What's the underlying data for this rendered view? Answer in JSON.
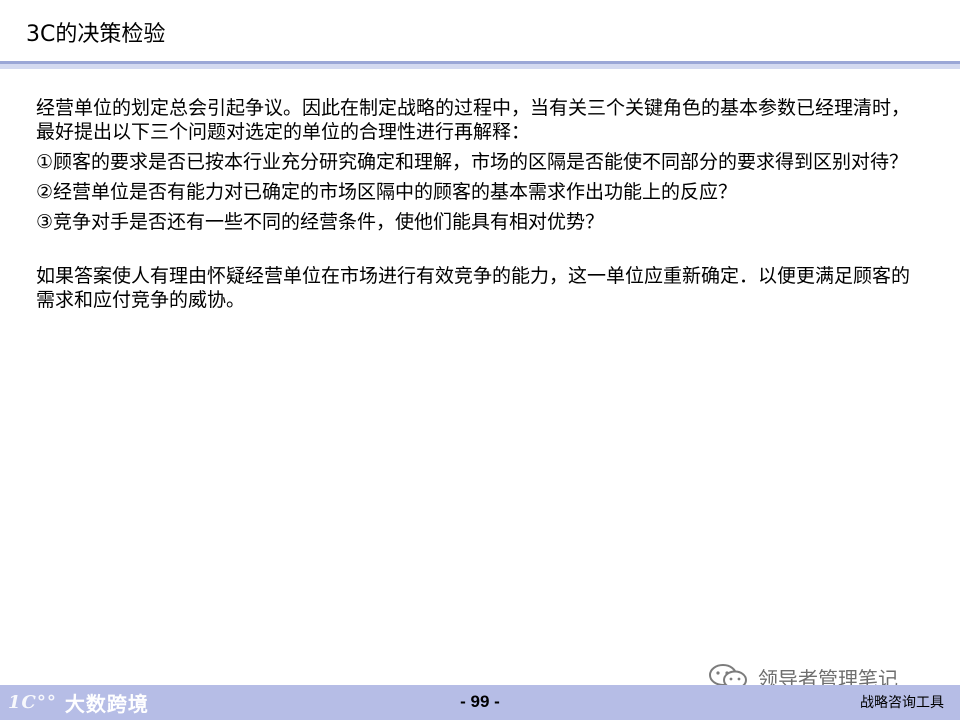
{
  "title": "3C的决策检验",
  "paragraphs": [
    "经营单位的划定总会引起争议。因此在制定战略的过程中，当有关三个关键角色的基本参数已经理清时，最好提出以下三个问题对选定的单位的合理性进行再解释：",
    "①顾客的要求是否已按本行业充分研究确定和理解，市场的区隔是否能使不同部分的要求得到区别对待？",
    "②经营单位是否有能力对已确定的市场区隔中的顾客的基本需求作出功能上的反应？",
    "③竞争对手是否还有一些不同的经营条件，使他们能具有相对优势？",
    "如果答案使人有理由怀疑经营单位在市场进行有效竞争的能力，这一单位应重新确定．以便更满足顾客的需求和应付竞争的威协。"
  ],
  "footer": {
    "logo_mark": "1C°°",
    "logo_text": "大数跨境",
    "page_number": "- 99 -",
    "right_text": "战略咨询工具"
  },
  "watermark": {
    "text": "领导者管理笔记"
  },
  "colors": {
    "title_rule": "#9aa6d6",
    "footer_band": "#b6bde6"
  }
}
